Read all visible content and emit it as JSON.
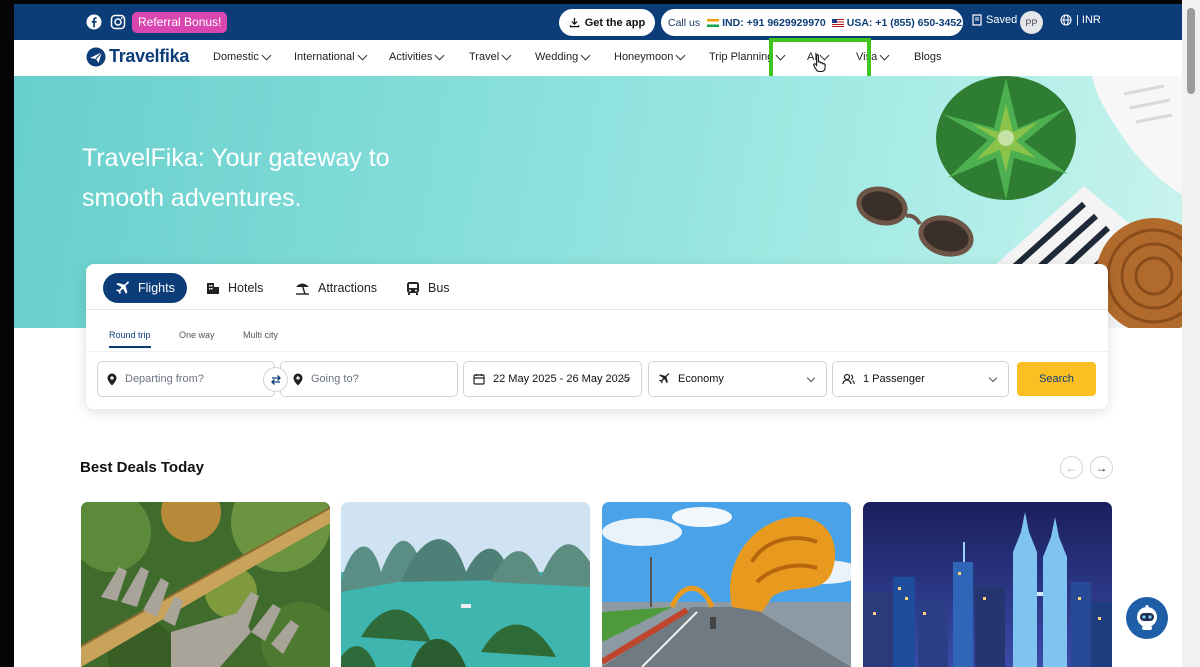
{
  "topbar": {
    "referral": "Referral Bonus!",
    "get_app": "Get the app",
    "call_us": "Call us",
    "ind_phone": "IND: +91 9629929970",
    "usa_phone": "USA: +1 (855) 650-3452",
    "saved": "Saved",
    "avatar_initials": "PP",
    "currency": "| INR"
  },
  "nav": {
    "logo": "Travelfika",
    "items": [
      "Domestic",
      "International",
      "Activities",
      "Travel",
      "Wedding",
      "Honeymoon",
      "Trip Planning",
      "AI",
      "Visa",
      "Blogs"
    ]
  },
  "hero": {
    "title": "TravelFika: Your gateway to smooth adventures."
  },
  "search": {
    "tabs": [
      "Flights",
      "Hotels",
      "Attractions",
      "Bus"
    ],
    "trip_types": [
      "Round trip",
      "One way",
      "Multi city"
    ],
    "from_placeholder": "Departing from?",
    "to_placeholder": "Going to?",
    "dates": "22 May 2025 - 26 May 2025",
    "cabin": "Economy",
    "passengers": "1 Passenger",
    "button": "Search"
  },
  "deals": {
    "title": "Best Deals Today",
    "cards": [
      "golden-bridge-hands",
      "ha-long-bay",
      "dragon-bridge",
      "kuala-lumpur-night"
    ]
  },
  "colors": {
    "brand_navy": "#0c3d78",
    "referral_pink": "#d946b0",
    "search_yellow": "#fbbf24",
    "highlight_green": "#3ec51f",
    "hero_teal": "#8be0dc"
  }
}
